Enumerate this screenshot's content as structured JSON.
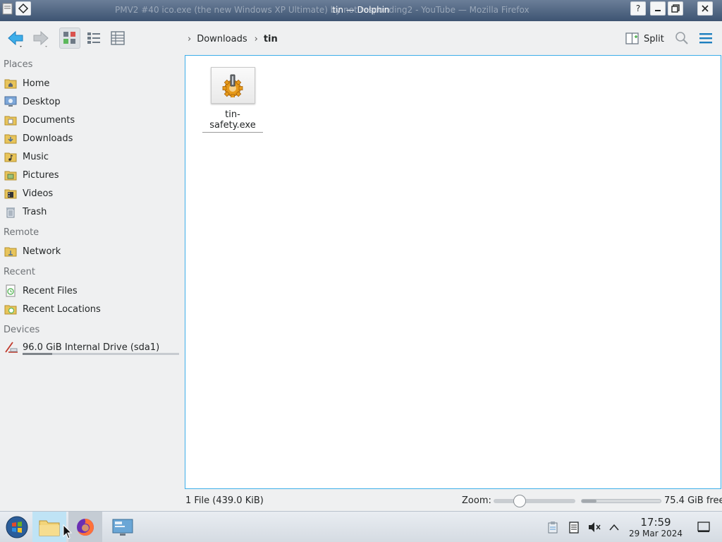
{
  "window": {
    "title": "tin — Dolphin",
    "background_title": "PMV2 #40 ico.exe (the new Windows XP Ultimate) by not responding2 - YouTube — Mozilla Firefox",
    "help_label": "?",
    "accent_color": "#3daee9"
  },
  "toolbar": {
    "back_icon": "arrow-left-icon",
    "forward_icon": "arrow-right-icon",
    "views": [
      "icons-view",
      "compact-view",
      "details-view"
    ],
    "active_view": "icons-view",
    "split_label": "Split",
    "search_icon": "search-icon",
    "menu_icon": "hamburger-menu-icon"
  },
  "breadcrumb": {
    "items": [
      "Downloads",
      "tin"
    ]
  },
  "sidebar": {
    "sections": [
      {
        "title": "Places",
        "items": [
          {
            "label": "Home",
            "icon": "home-folder-icon"
          },
          {
            "label": "Desktop",
            "icon": "desktop-icon"
          },
          {
            "label": "Documents",
            "icon": "documents-folder-icon"
          },
          {
            "label": "Downloads",
            "icon": "downloads-folder-icon"
          },
          {
            "label": "Music",
            "icon": "music-folder-icon"
          },
          {
            "label": "Pictures",
            "icon": "pictures-folder-icon"
          },
          {
            "label": "Videos",
            "icon": "videos-folder-icon"
          },
          {
            "label": "Trash",
            "icon": "trash-icon"
          }
        ]
      },
      {
        "title": "Remote",
        "items": [
          {
            "label": "Network",
            "icon": "network-folder-icon"
          }
        ]
      },
      {
        "title": "Recent",
        "items": [
          {
            "label": "Recent Files",
            "icon": "recent-files-icon"
          },
          {
            "label": "Recent Locations",
            "icon": "recent-locations-icon"
          }
        ]
      },
      {
        "title": "Devices",
        "items": [
          {
            "label": "96.0 GiB Internal Drive (sda1)",
            "icon": "hard-drive-icon",
            "usage_fraction": 0.19
          }
        ]
      }
    ]
  },
  "files": [
    {
      "name": "tin-safety.exe",
      "icon": "executable-gear-icon"
    }
  ],
  "status": {
    "summary": "1 File (439.0 KiB)",
    "zoom_label": "Zoom:",
    "zoom_fraction": 0.29,
    "free_label": "75.4 GiB free",
    "used_fraction": 0.19
  },
  "taskbar": {
    "apps": [
      {
        "name": "start-button",
        "icon": "windows-orb-icon"
      },
      {
        "name": "dolphin-task",
        "icon": "folder-icon",
        "state": "active"
      },
      {
        "name": "firefox-task",
        "icon": "firefox-icon",
        "state": "open"
      },
      {
        "name": "system-settings-task",
        "icon": "settings-monitor-icon",
        "state": "idle"
      }
    ],
    "tray": [
      "clipboard-icon",
      "notes-icon",
      "volume-muted-icon",
      "chevron-up-icon"
    ],
    "time": "17:59",
    "date": "29 Mar 2024"
  }
}
